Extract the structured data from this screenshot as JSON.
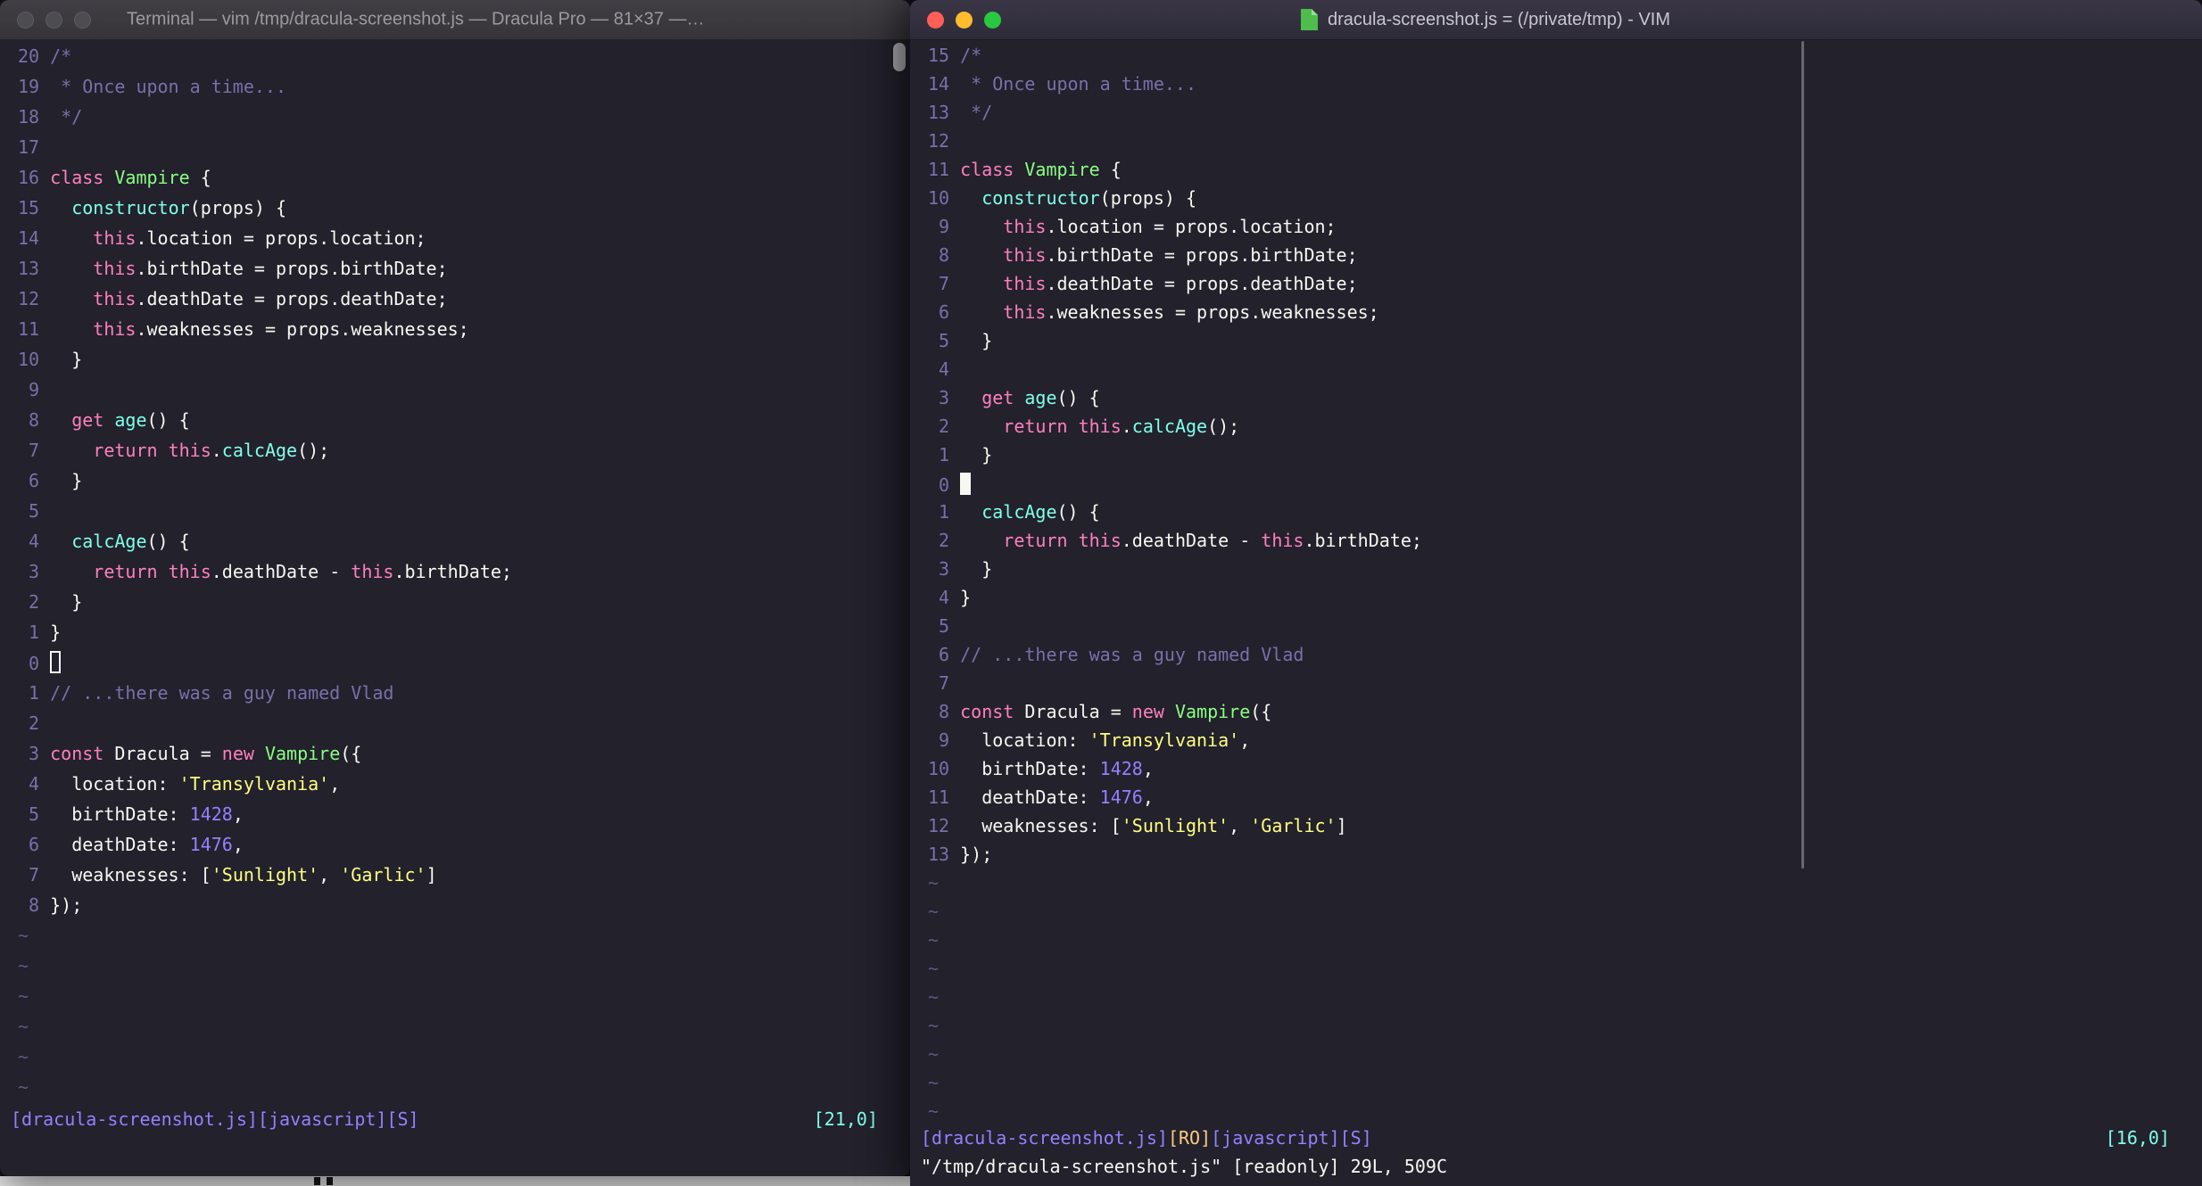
{
  "colors": {
    "background": "#22212C",
    "foreground": "#F8F8F2",
    "comment": "#7970A9",
    "pink": "#FF80BF",
    "green": "#8AFF80",
    "cyan": "#80FFEA",
    "yellow": "#FFFF80",
    "purple": "#9580FF",
    "orange": "#FFCA80",
    "traffic_red": "#FF5F57",
    "traffic_yellow": "#FEBC2E",
    "traffic_green": "#28C840"
  },
  "left_window": {
    "title": "Terminal — vim /tmp/dracula-screenshot.js — Dracula Pro — 81×37 —…",
    "tilde": "~",
    "tilde_count": 6,
    "status_left": [
      [
        "purple",
        "[dracula-screenshot.js][javascript][S]"
      ]
    ],
    "status_right": [
      [
        "cyan",
        "[21,0]"
      ]
    ],
    "cmdline": [],
    "lines": [
      {
        "n": "20",
        "s": [
          [
            "comment",
            "/*"
          ]
        ]
      },
      {
        "n": "19",
        "s": [
          [
            "comment",
            " * Once upon a time..."
          ]
        ]
      },
      {
        "n": "18",
        "s": [
          [
            "comment",
            " */"
          ]
        ]
      },
      {
        "n": "17",
        "s": []
      },
      {
        "n": "16",
        "s": [
          [
            "pink",
            "class "
          ],
          [
            "green",
            "Vampire "
          ],
          [
            "fg",
            "{"
          ]
        ]
      },
      {
        "n": "15",
        "s": [
          [
            "fg",
            "  "
          ],
          [
            "cyan",
            "constructor"
          ],
          [
            "fg",
            "(props) {"
          ]
        ]
      },
      {
        "n": "14",
        "s": [
          [
            "fg",
            "    "
          ],
          [
            "pink",
            "this"
          ],
          [
            "fg",
            ".location = props.location;"
          ]
        ]
      },
      {
        "n": "13",
        "s": [
          [
            "fg",
            "    "
          ],
          [
            "pink",
            "this"
          ],
          [
            "fg",
            ".birthDate = props.birthDate;"
          ]
        ]
      },
      {
        "n": "12",
        "s": [
          [
            "fg",
            "    "
          ],
          [
            "pink",
            "this"
          ],
          [
            "fg",
            ".deathDate = props.deathDate;"
          ]
        ]
      },
      {
        "n": "11",
        "s": [
          [
            "fg",
            "    "
          ],
          [
            "pink",
            "this"
          ],
          [
            "fg",
            ".weaknesses = props.weaknesses;"
          ]
        ]
      },
      {
        "n": "10",
        "s": [
          [
            "fg",
            "  }"
          ]
        ]
      },
      {
        "n": "9",
        "s": []
      },
      {
        "n": "8",
        "s": [
          [
            "fg",
            "  "
          ],
          [
            "pink",
            "get "
          ],
          [
            "cyan",
            "age"
          ],
          [
            "fg",
            "() {"
          ]
        ]
      },
      {
        "n": "7",
        "s": [
          [
            "fg",
            "    "
          ],
          [
            "pink",
            "return "
          ],
          [
            "pink",
            "this"
          ],
          [
            "fg",
            "."
          ],
          [
            "cyan",
            "calcAge"
          ],
          [
            "fg",
            "();"
          ]
        ]
      },
      {
        "n": "6",
        "s": [
          [
            "fg",
            "  }"
          ]
        ]
      },
      {
        "n": "5",
        "s": []
      },
      {
        "n": "4",
        "s": [
          [
            "fg",
            "  "
          ],
          [
            "cyan",
            "calcAge"
          ],
          [
            "fg",
            "() {"
          ]
        ]
      },
      {
        "n": "3",
        "s": [
          [
            "fg",
            "    "
          ],
          [
            "pink",
            "return "
          ],
          [
            "pink",
            "this"
          ],
          [
            "fg",
            ".deathDate - "
          ],
          [
            "pink",
            "this"
          ],
          [
            "fg",
            ".birthDate;"
          ]
        ]
      },
      {
        "n": "2",
        "s": [
          [
            "fg",
            "  }"
          ]
        ]
      },
      {
        "n": "1",
        "s": [
          [
            "fg",
            "}"
          ]
        ]
      },
      {
        "n": "0",
        "s": [],
        "cursor": "hollow"
      },
      {
        "n": "1",
        "s": [
          [
            "comment",
            "// ...there was a guy named Vlad"
          ]
        ]
      },
      {
        "n": "2",
        "s": []
      },
      {
        "n": "3",
        "s": [
          [
            "pink",
            "const "
          ],
          [
            "fg",
            "Dracula = "
          ],
          [
            "pink",
            "new "
          ],
          [
            "green",
            "Vampire"
          ],
          [
            "fg",
            "({"
          ]
        ]
      },
      {
        "n": "4",
        "s": [
          [
            "fg",
            "  location: "
          ],
          [
            "yellow",
            "'Transylvania'"
          ],
          [
            "fg",
            ","
          ]
        ]
      },
      {
        "n": "5",
        "s": [
          [
            "fg",
            "  birthDate: "
          ],
          [
            "purple",
            "1428"
          ],
          [
            "fg",
            ","
          ]
        ]
      },
      {
        "n": "6",
        "s": [
          [
            "fg",
            "  deathDate: "
          ],
          [
            "purple",
            "1476"
          ],
          [
            "fg",
            ","
          ]
        ]
      },
      {
        "n": "7",
        "s": [
          [
            "fg",
            "  weaknesses: ["
          ],
          [
            "yellow",
            "'Sunlight'"
          ],
          [
            "fg",
            ", "
          ],
          [
            "yellow",
            "'Garlic'"
          ],
          [
            "fg",
            "]"
          ]
        ]
      },
      {
        "n": "8",
        "s": [
          [
            "fg",
            "});"
          ]
        ]
      }
    ]
  },
  "right_window": {
    "title": "dracula-screenshot.js = (/private/tmp) - VIM",
    "file_icon": "javascript-file-icon",
    "tilde": "~",
    "tilde_count": 9,
    "status_left": [
      [
        "purple",
        "[dracula-screenshot.js]"
      ],
      [
        "orange",
        "[RO]"
      ],
      [
        "purple",
        "[javascript][S]"
      ]
    ],
    "status_right": [
      [
        "cyan",
        "[16,0]"
      ]
    ],
    "cmdline": [
      [
        "fg",
        "\"/tmp/dracula-screenshot.js\" [readonly] 29L, 509C"
      ]
    ],
    "lines": [
      {
        "n": "15",
        "s": [
          [
            "comment",
            "/*"
          ]
        ]
      },
      {
        "n": "14",
        "s": [
          [
            "comment",
            " * Once upon a time..."
          ]
        ]
      },
      {
        "n": "13",
        "s": [
          [
            "comment",
            " */"
          ]
        ]
      },
      {
        "n": "12",
        "s": []
      },
      {
        "n": "11",
        "s": [
          [
            "pink",
            "class "
          ],
          [
            "green",
            "Vampire "
          ],
          [
            "fg",
            "{"
          ]
        ]
      },
      {
        "n": "10",
        "s": [
          [
            "fg",
            "  "
          ],
          [
            "cyan",
            "constructor"
          ],
          [
            "fg",
            "(props) {"
          ]
        ]
      },
      {
        "n": "9",
        "s": [
          [
            "fg",
            "    "
          ],
          [
            "pink",
            "this"
          ],
          [
            "fg",
            ".location = props.location;"
          ]
        ]
      },
      {
        "n": "8",
        "s": [
          [
            "fg",
            "    "
          ],
          [
            "pink",
            "this"
          ],
          [
            "fg",
            ".birthDate = props.birthDate;"
          ]
        ]
      },
      {
        "n": "7",
        "s": [
          [
            "fg",
            "    "
          ],
          [
            "pink",
            "this"
          ],
          [
            "fg",
            ".deathDate = props.deathDate;"
          ]
        ]
      },
      {
        "n": "6",
        "s": [
          [
            "fg",
            "    "
          ],
          [
            "pink",
            "this"
          ],
          [
            "fg",
            ".weaknesses = props.weaknesses;"
          ]
        ]
      },
      {
        "n": "5",
        "s": [
          [
            "fg",
            "  }"
          ]
        ]
      },
      {
        "n": "4",
        "s": []
      },
      {
        "n": "3",
        "s": [
          [
            "fg",
            "  "
          ],
          [
            "pink",
            "get "
          ],
          [
            "cyan",
            "age"
          ],
          [
            "fg",
            "() {"
          ]
        ]
      },
      {
        "n": "2",
        "s": [
          [
            "fg",
            "    "
          ],
          [
            "pink",
            "return "
          ],
          [
            "pink",
            "this"
          ],
          [
            "fg",
            "."
          ],
          [
            "cyan",
            "calcAge"
          ],
          [
            "fg",
            "();"
          ]
        ]
      },
      {
        "n": "1",
        "s": [
          [
            "fg",
            "  }"
          ]
        ]
      },
      {
        "n": "0",
        "s": [],
        "cursor": "block"
      },
      {
        "n": "1",
        "s": [
          [
            "fg",
            "  "
          ],
          [
            "cyan",
            "calcAge"
          ],
          [
            "fg",
            "() {"
          ]
        ]
      },
      {
        "n": "2",
        "s": [
          [
            "fg",
            "    "
          ],
          [
            "pink",
            "return "
          ],
          [
            "pink",
            "this"
          ],
          [
            "fg",
            ".deathDate - "
          ],
          [
            "pink",
            "this"
          ],
          [
            "fg",
            ".birthDate;"
          ]
        ]
      },
      {
        "n": "3",
        "s": [
          [
            "fg",
            "  }"
          ]
        ]
      },
      {
        "n": "4",
        "s": [
          [
            "fg",
            "}"
          ]
        ]
      },
      {
        "n": "5",
        "s": []
      },
      {
        "n": "6",
        "s": [
          [
            "comment",
            "// ...there was a guy named Vlad"
          ]
        ]
      },
      {
        "n": "7",
        "s": []
      },
      {
        "n": "8",
        "s": [
          [
            "pink",
            "const "
          ],
          [
            "fg",
            "Dracula = "
          ],
          [
            "pink",
            "new "
          ],
          [
            "green",
            "Vampire"
          ],
          [
            "fg",
            "({"
          ]
        ]
      },
      {
        "n": "9",
        "s": [
          [
            "fg",
            "  location: "
          ],
          [
            "yellow",
            "'Transylvania'"
          ],
          [
            "fg",
            ","
          ]
        ]
      },
      {
        "n": "10",
        "s": [
          [
            "fg",
            "  birthDate: "
          ],
          [
            "purple",
            "1428"
          ],
          [
            "fg",
            ","
          ]
        ]
      },
      {
        "n": "11",
        "s": [
          [
            "fg",
            "  deathDate: "
          ],
          [
            "purple",
            "1476"
          ],
          [
            "fg",
            ","
          ]
        ]
      },
      {
        "n": "12",
        "s": [
          [
            "fg",
            "  weaknesses: ["
          ],
          [
            "yellow",
            "'Sunlight'"
          ],
          [
            "fg",
            ", "
          ],
          [
            "yellow",
            "'Garlic'"
          ],
          [
            "fg",
            "]"
          ]
        ]
      },
      {
        "n": "13",
        "s": [
          [
            "fg",
            "});"
          ]
        ]
      }
    ]
  }
}
